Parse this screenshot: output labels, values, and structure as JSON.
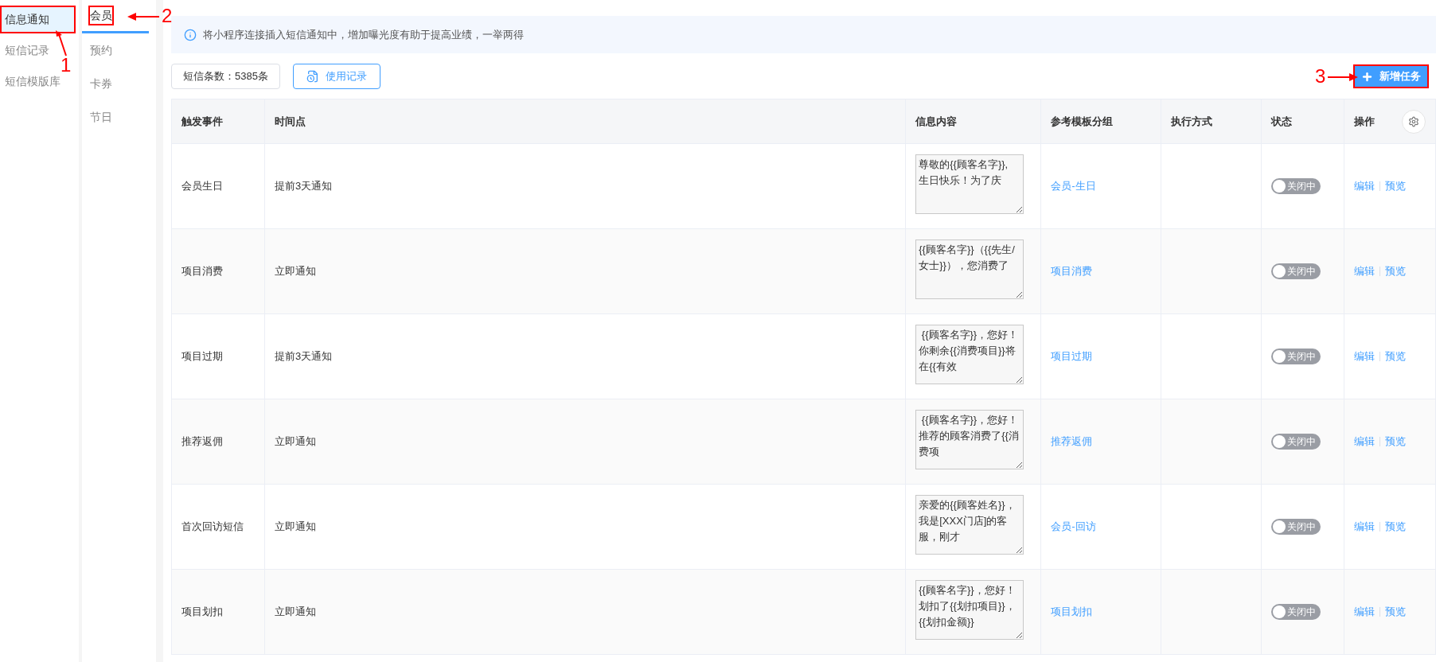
{
  "sidebar": {
    "items": [
      {
        "label": "信息通知",
        "selected": true
      },
      {
        "label": "短信记录",
        "selected": false
      },
      {
        "label": "短信模版库",
        "selected": false
      }
    ]
  },
  "subtabs": [
    {
      "label": "会员",
      "selected": true
    },
    {
      "label": "预约",
      "selected": false
    },
    {
      "label": "卡券",
      "selected": false
    },
    {
      "label": "节日",
      "selected": false
    }
  ],
  "notice": "将小程序连接插入短信通知中，增加曝光度有助于提高业绩，一举两得",
  "toolbar": {
    "sms_count": "短信条数：5385条",
    "usage_button": "使用记录",
    "add_button": "新增任务"
  },
  "table": {
    "columns": [
      "触发事件",
      "时间点",
      "信息内容",
      "参考模板分组",
      "执行方式",
      "状态",
      "操作"
    ],
    "rows": [
      {
        "event": "会员生日",
        "timing": "提前3天通知",
        "content": "尊敬的{{顾客名字}},\n生日快乐！为了庆",
        "group": "会员-生日",
        "status": {
          "on": false,
          "label": "关闭中"
        },
        "actions": [
          "编辑",
          "预览"
        ]
      },
      {
        "event": "项目消费",
        "timing": "立即通知",
        "content": "{{顾客名字}}（{{先生/女士}}），您消费了",
        "group": "项目消费",
        "status": {
          "on": false,
          "label": "关闭中"
        },
        "actions": [
          "编辑",
          "预览"
        ]
      },
      {
        "event": "项目过期",
        "timing": "提前3天通知",
        "content": " {{顾客名字}}，您好！你剩余{{消费项目}}将在{{有效",
        "group": "项目过期",
        "status": {
          "on": false,
          "label": "关闭中"
        },
        "actions": [
          "编辑",
          "预览"
        ]
      },
      {
        "event": "推荐返佣",
        "timing": "立即通知",
        "content": " {{顾客名字}}，您好！推荐的顾客消费了{{消费项",
        "group": "推荐返佣",
        "status": {
          "on": false,
          "label": "关闭中"
        },
        "actions": [
          "编辑",
          "预览"
        ]
      },
      {
        "event": "首次回访短信",
        "timing": "立即通知",
        "content": "亲爱的{{顾客姓名}}，我是[XXX门店]的客服，刚才",
        "group": "会员-回访",
        "status": {
          "on": false,
          "label": "关闭中"
        },
        "actions": [
          "编辑",
          "预览"
        ]
      },
      {
        "event": "项目划扣",
        "timing": "立即通知",
        "content": "{{顾客名字}}，您好！划扣了{{划扣项目}}，{{划扣金额}}",
        "group": "项目划扣",
        "status": {
          "on": false,
          "label": "关闭中"
        },
        "actions": [
          "编辑",
          "预览"
        ]
      }
    ]
  },
  "callouts": [
    "1",
    "2",
    "3"
  ]
}
